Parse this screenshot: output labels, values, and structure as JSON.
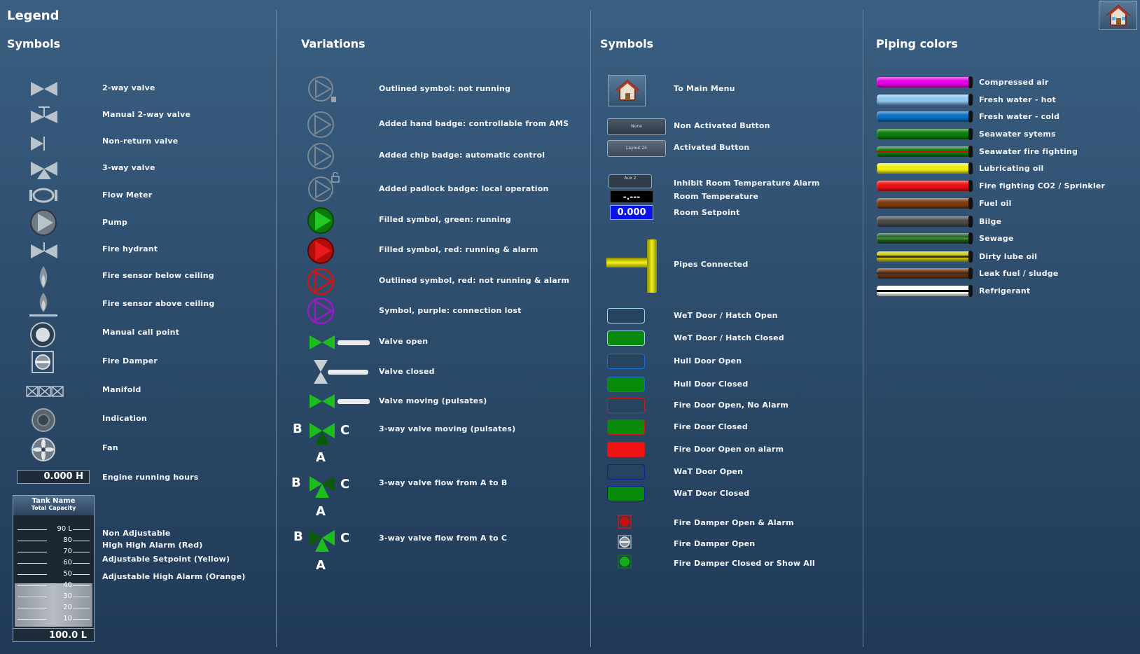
{
  "title": "Legend",
  "columns": {
    "symbols1": {
      "header": "Symbols",
      "items": [
        "2-way valve",
        "Manual 2-way valve",
        "Non-return valve",
        "3-way valve",
        "Flow Meter",
        "Pump",
        "Fire hydrant",
        "Fire sensor below ceiling",
        "Fire sensor above ceiling",
        "Manual call point",
        "Fire Damper",
        "Manifold",
        "Indication",
        "Fan",
        "Engine running hours"
      ],
      "engine_hours": "0.000 H",
      "tank": {
        "name": "Tank Name",
        "capacity": "Total Capacity",
        "ticks": [
          "90 L",
          "80",
          "70",
          "60",
          "50",
          "40",
          "30",
          "20",
          "10"
        ],
        "fill_percent": 40,
        "value": "100.0 L"
      },
      "tank_labels": [
        "Non Adjustable",
        "High High Alarm (Red)",
        "Adjustable Setpoint (Yellow)",
        "Adjustable High Alarm (Orange)"
      ]
    },
    "variations": {
      "header": "Variations",
      "items": [
        "Outlined symbol: not running",
        "Added hand badge: controllable from AMS",
        "Added chip badge: automatic control",
        "Added padlock badge: local operation",
        "Filled symbol, green: running",
        "Filled symbol, red: running & alarm",
        "Outlined symbol, red: not running & alarm",
        "Symbol, purple: connection lost",
        "Valve open",
        "Valve closed",
        "Valve moving (pulsates)",
        "3-way valve moving (pulsates)",
        "3-way valve flow from  A to B",
        "3-way valve flow from A to C"
      ],
      "port_b": "B",
      "port_c": "C",
      "port_a": "A"
    },
    "symbols2": {
      "header": "Symbols",
      "items": [
        "To Main Menu",
        "Non Activated Button",
        "Activated Button",
        "Inhibit Room Temperature Alarm",
        "Room Temperature",
        "Room Setpoint",
        "Pipes Connected",
        "WeT Door / Hatch Open",
        "WeT Door / Hatch Closed",
        "Hull Door Open",
        "Hull Door Closed",
        "Fire Door Open, No Alarm",
        "Fire Door Closed",
        "Fire Door Open  on alarm",
        "WaT Door Open",
        "WaT Door Closed",
        "Fire Damper Open & Alarm",
        "Fire Damper Open",
        "Fire Damper Closed or Show All"
      ],
      "btn_none": "None",
      "btn_layout": "Layout 24",
      "inhibit_text": "Aux\n2",
      "room_temp": "-.---",
      "room_setpoint": "0.000"
    },
    "piping": {
      "header": "Piping colors",
      "items": [
        {
          "label": "Compressed air",
          "color": "#e600e6"
        },
        {
          "label": "Fresh water - hot",
          "color": "#8ec6f0"
        },
        {
          "label": "Fresh water - cold",
          "color": "#0a6fc2"
        },
        {
          "label": "Seawater sytems",
          "color": "#0d7d0d"
        },
        {
          "label": "Seawater fire fighting",
          "color": "#0d7d0d",
          "stripe": "#cc1010"
        },
        {
          "label": "Lubricating oil",
          "color": "#f0ee10"
        },
        {
          "label": "Fire fighting CO2 / Sprinkler",
          "color": "#e81010"
        },
        {
          "label": "Fuel oil",
          "color": "#7a3c10"
        },
        {
          "label": "Bilge",
          "color": "#4a4a4a"
        },
        {
          "label": "Sewage",
          "color": "#1f5a1f",
          "stripe": "#3c8a3c"
        },
        {
          "label": "Dirty lube oil",
          "color": "#c9c40e",
          "stripe": "#333"
        },
        {
          "label": "Leak fuel / sludge",
          "color": "#6a3510",
          "stripe": "#333"
        },
        {
          "label": "Refrigerant",
          "color": "#ffffff",
          "stripe": "#000"
        }
      ]
    }
  }
}
